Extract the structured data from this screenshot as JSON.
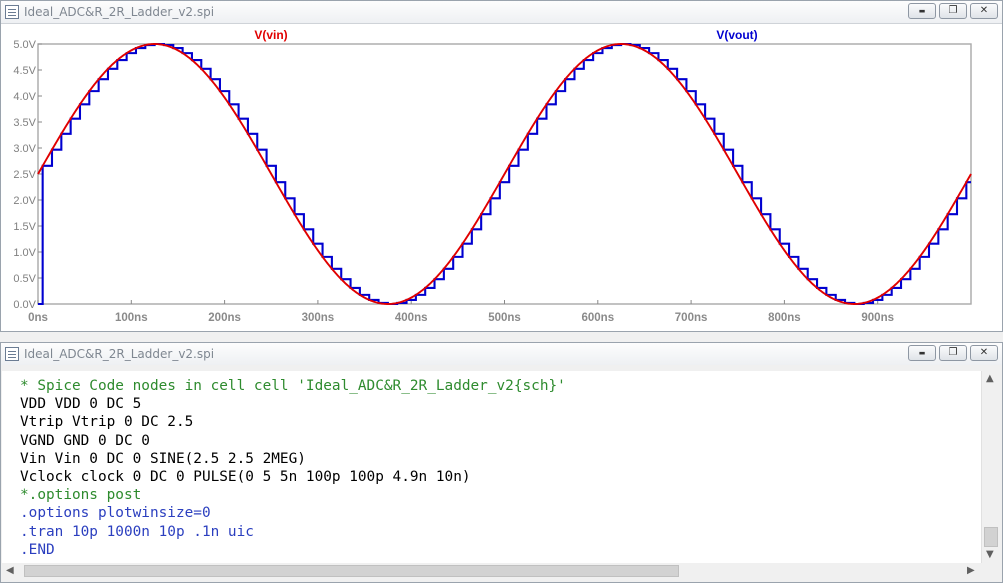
{
  "plot_window": {
    "title": "Ideal_ADC&R_2R_Ladder_v2.spi",
    "controls": {
      "minimize": "▬",
      "restore": "❐",
      "close": "✕"
    }
  },
  "chart_data": {
    "type": "line",
    "title": "",
    "x_unit": "ns",
    "xlim": [
      0,
      1000
    ],
    "ylim": [
      0,
      5
    ],
    "x_ticks": [
      "0ns",
      "100ns",
      "200ns",
      "300ns",
      "400ns",
      "500ns",
      "600ns",
      "700ns",
      "800ns",
      "900ns"
    ],
    "x_tick_values": [
      0,
      100,
      200,
      300,
      400,
      500,
      600,
      700,
      800,
      900
    ],
    "y_ticks": [
      "0.0V",
      "0.5V",
      "1.0V",
      "1.5V",
      "2.0V",
      "2.5V",
      "3.0V",
      "3.5V",
      "4.0V",
      "4.5V",
      "5.0V"
    ],
    "y_tick_values": [
      0,
      0.5,
      1,
      1.5,
      2,
      2.5,
      3,
      3.5,
      4,
      4.5,
      5
    ],
    "grid": false,
    "legend": "top",
    "series": [
      {
        "name": "V(vin)",
        "color": "#e00000",
        "kind": "sine",
        "offset": 2.5,
        "amplitude": 2.5,
        "frequency_MHz": 2
      },
      {
        "name": "V(vout)",
        "color": "#0000d0",
        "kind": "staircase",
        "step_ns": 10,
        "initial": 0,
        "start_ns": 5
      }
    ]
  },
  "code_window": {
    "title": "Ideal_ADC&R_2R_Ladder_v2.spi",
    "controls": {
      "minimize": "▬",
      "restore": "❐",
      "close": "✕"
    },
    "lines": [
      {
        "text": "* Spice Code nodes in cell cell 'Ideal_ADC&R_2R_Ladder_v2{sch}'",
        "color": "green"
      },
      {
        "text": "VDD VDD 0 DC 5",
        "color": "black"
      },
      {
        "text": "Vtrip Vtrip 0 DC 2.5",
        "color": "black"
      },
      {
        "text": "VGND GND 0 DC 0",
        "color": "black"
      },
      {
        "text": "Vin Vin 0 DC 0 SINE(2.5 2.5 2MEG)",
        "color": "black"
      },
      {
        "text": "Vclock clock 0 DC 0 PULSE(0 5 5n 100p 100p 4.9n 10n)",
        "color": "black"
      },
      {
        "text": "*.options post",
        "color": "green"
      },
      {
        "text": ".options plotwinsize=0",
        "color": "blue"
      },
      {
        "text": ".tran 10p 1000n 10p .1n uic",
        "color": "blue"
      },
      {
        "text": ".END",
        "color": "blue"
      }
    ]
  }
}
